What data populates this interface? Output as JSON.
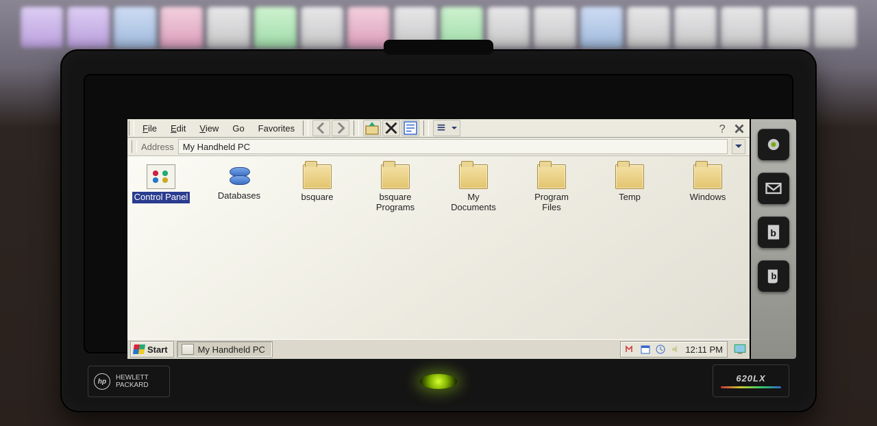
{
  "device": {
    "brand_line1": "HEWLETT",
    "brand_line2": "PACKARD",
    "brand_mono": "hp",
    "model": "620LX"
  },
  "menubar": {
    "file": "File",
    "edit": "Edit",
    "view": "View",
    "go": "Go",
    "favorites": "Favorites"
  },
  "addressbar": {
    "label": "Address",
    "path": "My Handheld PC"
  },
  "items": [
    {
      "label": "Control Panel",
      "kind": "control",
      "selected": true
    },
    {
      "label": "Databases",
      "kind": "db",
      "selected": false
    },
    {
      "label": "bsquare",
      "kind": "folder",
      "selected": false
    },
    {
      "label": "bsquare Programs",
      "kind": "folder",
      "selected": false
    },
    {
      "label": "My Documents",
      "kind": "folder",
      "selected": false
    },
    {
      "label": "Program Files",
      "kind": "folder",
      "selected": false
    },
    {
      "label": "Temp",
      "kind": "folder",
      "selected": false
    },
    {
      "label": "Windows",
      "kind": "folder",
      "selected": false
    }
  ],
  "taskbar": {
    "start": "Start",
    "active_window": "My Handheld PC",
    "clock": "12:11 PM"
  }
}
